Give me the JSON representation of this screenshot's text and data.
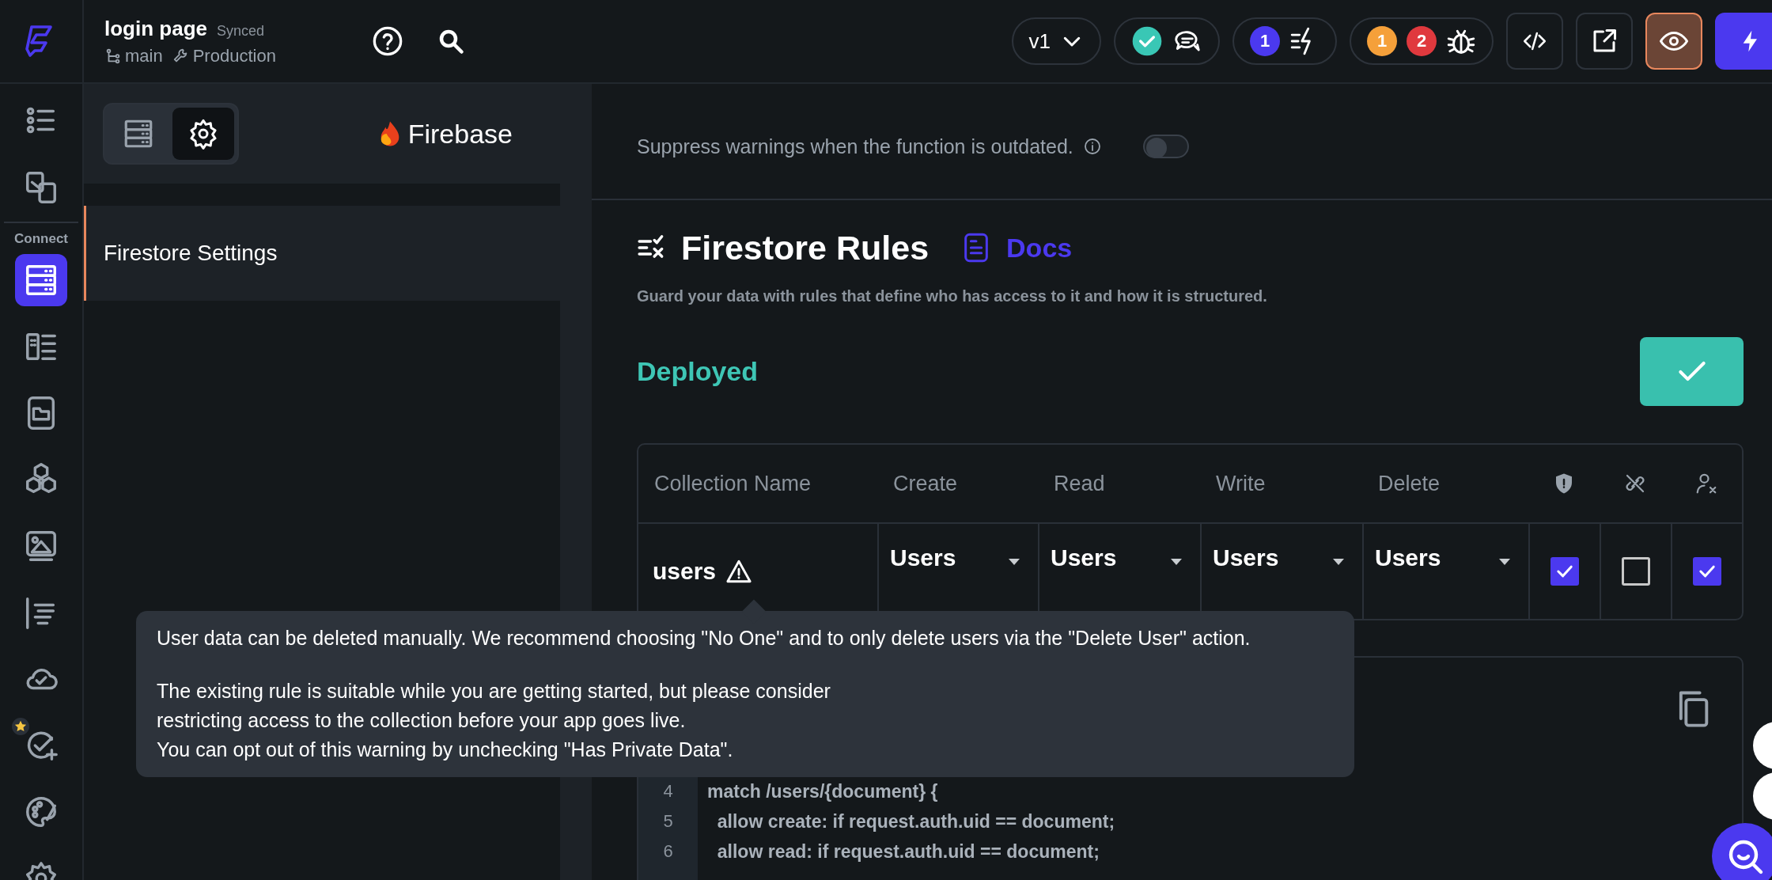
{
  "topbar": {
    "project": "login page",
    "sync_status": "Synced",
    "branch": "main",
    "environment": "Production",
    "version": "v1",
    "action_count": "1",
    "warning_count": "1",
    "error_count": "2"
  },
  "rail": {
    "section_label": "Connect",
    "items": [
      {
        "selected": false
      },
      {
        "selected": false
      },
      {
        "selected": true
      },
      {
        "selected": false
      },
      {
        "selected": false
      },
      {
        "selected": false
      },
      {
        "selected": false
      },
      {
        "selected": false
      },
      {
        "selected": false
      },
      {
        "selected": false
      },
      {
        "selected": false
      },
      {
        "selected": false
      }
    ]
  },
  "panel": {
    "tabs": [
      {
        "selected": false
      },
      {
        "selected": true
      }
    ],
    "provider": "Firebase",
    "items": [
      {
        "label": "Firestore Settings",
        "selected": true
      }
    ]
  },
  "main": {
    "suppress_warnings": {
      "label": "Suppress warnings when the function is outdated.",
      "on": false
    },
    "rules": {
      "title": "Firestore Rules",
      "docs_link": "Docs",
      "description": "Guard your data with rules that define who has access to it and how it is structured.",
      "status": "Deployed"
    },
    "table": {
      "columns": [
        "Collection Name",
        "Create",
        "Read",
        "Write",
        "Delete"
      ],
      "rows": [
        {
          "name": "users",
          "warning": true,
          "create": "Users",
          "read": "Users",
          "write": "Users",
          "delete": "Users",
          "flags": [
            {
              "checked": true
            },
            {
              "checked": false
            },
            {
              "checked": true
            }
          ]
        }
      ]
    },
    "tooltip": {
      "message": "User data can be deleted manually. We recommend choosing \"No One\" and to only delete users via the \"Delete User\" action.",
      "details": [
        "The existing rule is suitable while you are getting started, but please consider",
        "restricting access to the collection before your app goes live.",
        "You can opt out of this warning by unchecking \"Has Private Data\"."
      ]
    },
    "code": {
      "lines": [
        {
          "number": "4",
          "text": "match /users/{document} {"
        },
        {
          "number": "5",
          "text": "  allow create: if request.auth.uid == document;"
        },
        {
          "number": "6",
          "text": "  allow read: if request.auth.uid == document;"
        }
      ]
    }
  }
}
